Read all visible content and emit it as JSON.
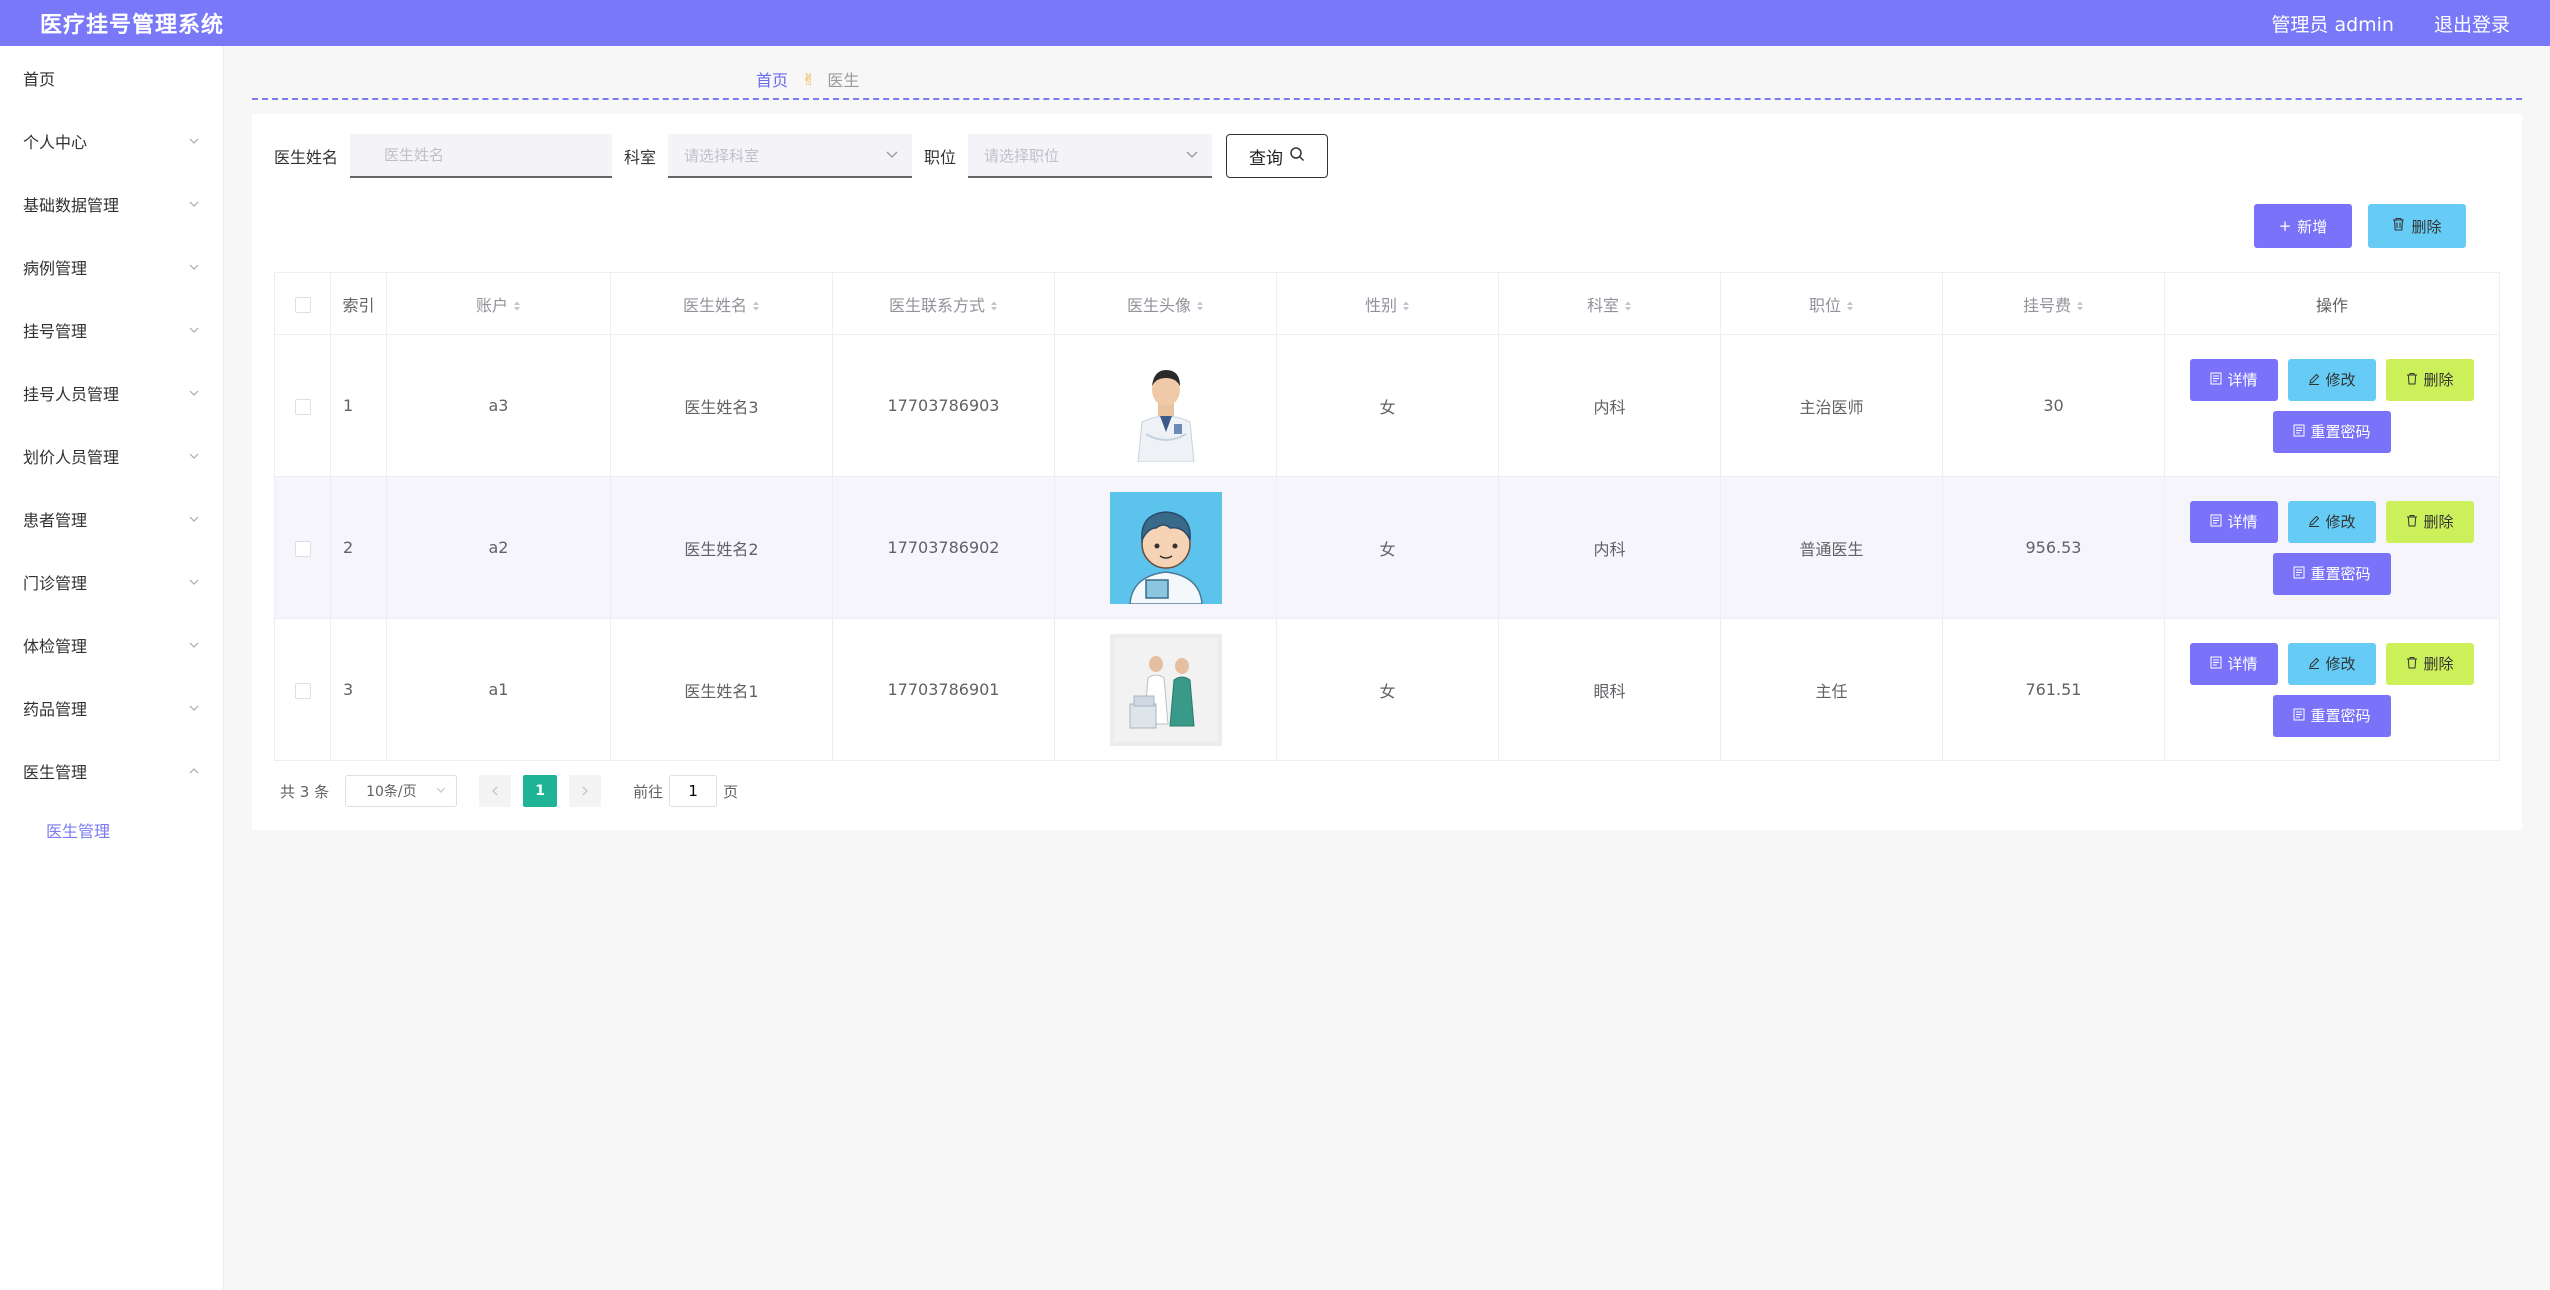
{
  "header": {
    "title": "医疗挂号管理系统",
    "user": "管理员 admin",
    "logout": "退出登录",
    "bg_color": "#7878f8"
  },
  "sidebar": {
    "items": [
      {
        "label": "首页",
        "expandable": false
      },
      {
        "label": "个人中心",
        "expandable": true
      },
      {
        "label": "基础数据管理",
        "expandable": true
      },
      {
        "label": "病例管理",
        "expandable": true
      },
      {
        "label": "挂号管理",
        "expandable": true
      },
      {
        "label": "挂号人员管理",
        "expandable": true
      },
      {
        "label": "划价人员管理",
        "expandable": true
      },
      {
        "label": "患者管理",
        "expandable": true
      },
      {
        "label": "门诊管理",
        "expandable": true
      },
      {
        "label": "体检管理",
        "expandable": true
      },
      {
        "label": "药品管理",
        "expandable": true
      },
      {
        "label": "医生管理",
        "expandable": true,
        "expanded": true
      }
    ],
    "sub_item": "医生管理"
  },
  "breadcrumb": {
    "home": "首页",
    "current": "医生"
  },
  "search": {
    "name_label": "医生姓名",
    "name_placeholder": "医生姓名",
    "dept_label": "科室",
    "dept_placeholder": "请选择科室",
    "pos_label": "职位",
    "pos_placeholder": "请选择职位",
    "query_label": "查询"
  },
  "actions": {
    "add_label": "新增",
    "delete_label": "删除"
  },
  "table": {
    "headers": {
      "index": "索引",
      "account": "账户",
      "name": "医生姓名",
      "phone": "医生联系方式",
      "avatar": "医生头像",
      "gender": "性别",
      "dept": "科室",
      "position": "职位",
      "fee": "挂号费",
      "ops": "操作"
    },
    "rows": [
      {
        "index": "1",
        "account": "a3",
        "name": "医生姓名3",
        "phone": "17703786903",
        "gender": "女",
        "dept": "内科",
        "position": "主治医师",
        "fee": "30"
      },
      {
        "index": "2",
        "account": "a2",
        "name": "医生姓名2",
        "phone": "17703786902",
        "gender": "女",
        "dept": "内科",
        "position": "普通医生",
        "fee": "956.53"
      },
      {
        "index": "3",
        "account": "a1",
        "name": "医生姓名1",
        "phone": "17703786901",
        "gender": "女",
        "dept": "眼科",
        "position": "主任",
        "fee": "761.51"
      }
    ],
    "ops": {
      "detail": "详情",
      "edit": "修改",
      "delete": "删除",
      "reset": "重置密码"
    }
  },
  "pager": {
    "total": "共 3 条",
    "page_size": "10条/页",
    "current": "1",
    "goto_prefix": "前往",
    "goto_value": "1",
    "goto_suffix": "页"
  }
}
